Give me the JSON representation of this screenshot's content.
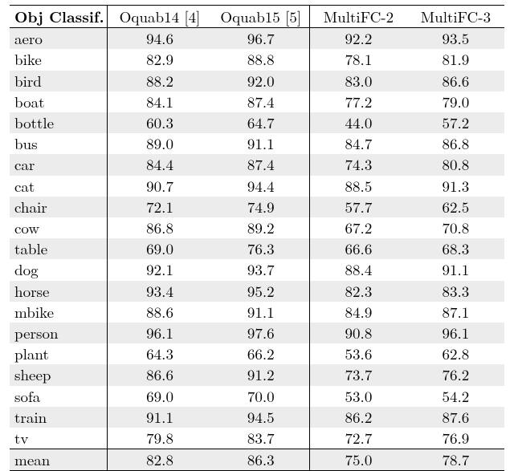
{
  "chart_data": {
    "type": "table",
    "title": "Obj Classif.",
    "columns": [
      "Oquab14 [4]",
      "Oquab15 [5]",
      "MultiFC-2",
      "MultiFC-3"
    ],
    "categories": [
      "aero",
      "bike",
      "bird",
      "boat",
      "bottle",
      "bus",
      "car",
      "cat",
      "chair",
      "cow",
      "table",
      "dog",
      "horse",
      "mbike",
      "person",
      "plant",
      "sheep",
      "sofa",
      "train",
      "tv"
    ],
    "series": [
      {
        "name": "Oquab14 [4]",
        "values": [
          94.6,
          82.9,
          88.2,
          84.1,
          60.3,
          89.0,
          84.4,
          90.7,
          72.1,
          86.8,
          69.0,
          92.1,
          93.4,
          88.6,
          96.1,
          64.3,
          86.6,
          69.0,
          91.1,
          79.8
        ]
      },
      {
        "name": "Oquab15 [5]",
        "values": [
          96.7,
          88.8,
          92.0,
          87.4,
          64.7,
          91.1,
          87.4,
          94.4,
          74.9,
          89.2,
          76.3,
          93.7,
          95.2,
          91.1,
          97.6,
          66.2,
          91.2,
          70.0,
          94.5,
          83.7
        ]
      },
      {
        "name": "MultiFC-2",
        "values": [
          92.2,
          78.1,
          83.0,
          77.2,
          44.0,
          84.7,
          74.3,
          88.5,
          57.7,
          67.2,
          66.6,
          88.4,
          82.3,
          84.9,
          90.8,
          53.6,
          73.7,
          53.0,
          86.2,
          72.7
        ]
      },
      {
        "name": "MultiFC-3",
        "values": [
          93.5,
          81.9,
          86.6,
          79.0,
          57.2,
          86.8,
          80.8,
          91.3,
          62.5,
          70.8,
          68.3,
          91.1,
          83.3,
          87.1,
          96.1,
          62.8,
          76.2,
          54.2,
          87.6,
          76.9
        ]
      }
    ],
    "mean": {
      "label": "mean",
      "values": [
        82.8,
        86.3,
        75.0,
        78.7
      ]
    }
  },
  "header": {
    "label_html": "Obj Classif.",
    "c1": "Oquab14 [4]",
    "c2": "Oquab15 [5]",
    "c3": "MultiFC-2",
    "c4": "MultiFC-3"
  },
  "rows": [
    {
      "label": "aero",
      "v": [
        "94.6",
        "96.7",
        "92.2",
        "93.5"
      ]
    },
    {
      "label": "bike",
      "v": [
        "82.9",
        "88.8",
        "78.1",
        "81.9"
      ]
    },
    {
      "label": "bird",
      "v": [
        "88.2",
        "92.0",
        "83.0",
        "86.6"
      ]
    },
    {
      "label": "boat",
      "v": [
        "84.1",
        "87.4",
        "77.2",
        "79.0"
      ]
    },
    {
      "label": "bottle",
      "v": [
        "60.3",
        "64.7",
        "44.0",
        "57.2"
      ]
    },
    {
      "label": "bus",
      "v": [
        "89.0",
        "91.1",
        "84.7",
        "86.8"
      ]
    },
    {
      "label": "car",
      "v": [
        "84.4",
        "87.4",
        "74.3",
        "80.8"
      ]
    },
    {
      "label": "cat",
      "v": [
        "90.7",
        "94.4",
        "88.5",
        "91.3"
      ]
    },
    {
      "label": "chair",
      "v": [
        "72.1",
        "74.9",
        "57.7",
        "62.5"
      ]
    },
    {
      "label": "cow",
      "v": [
        "86.8",
        "89.2",
        "67.2",
        "70.8"
      ]
    },
    {
      "label": "table",
      "v": [
        "69.0",
        "76.3",
        "66.6",
        "68.3"
      ]
    },
    {
      "label": "dog",
      "v": [
        "92.1",
        "93.7",
        "88.4",
        "91.1"
      ]
    },
    {
      "label": "horse",
      "v": [
        "93.4",
        "95.2",
        "82.3",
        "83.3"
      ]
    },
    {
      "label": "mbike",
      "v": [
        "88.6",
        "91.1",
        "84.9",
        "87.1"
      ]
    },
    {
      "label": "person",
      "v": [
        "96.1",
        "97.6",
        "90.8",
        "96.1"
      ]
    },
    {
      "label": "plant",
      "v": [
        "64.3",
        "66.2",
        "53.6",
        "62.8"
      ]
    },
    {
      "label": "sheep",
      "v": [
        "86.6",
        "91.2",
        "73.7",
        "76.2"
      ]
    },
    {
      "label": "sofa",
      "v": [
        "69.0",
        "70.0",
        "53.0",
        "54.2"
      ]
    },
    {
      "label": "train",
      "v": [
        "91.1",
        "94.5",
        "86.2",
        "87.6"
      ]
    },
    {
      "label": "tv",
      "v": [
        "79.8",
        "83.7",
        "72.7",
        "76.9"
      ]
    }
  ],
  "mean": {
    "label": "mean",
    "v": [
      "82.8",
      "86.3",
      "75.0",
      "78.7"
    ]
  }
}
